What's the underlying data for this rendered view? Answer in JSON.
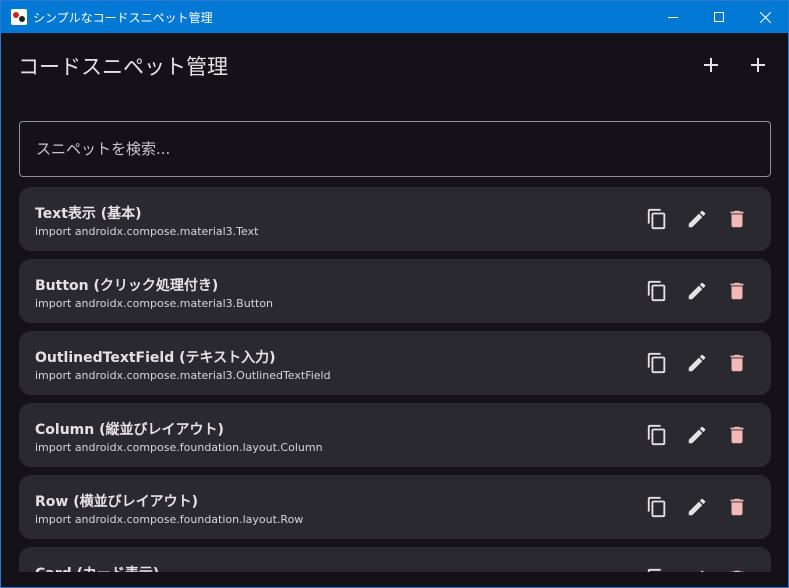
{
  "window": {
    "title": "シンプルなコードスニペット管理"
  },
  "header": {
    "title": "コードスニペット管理"
  },
  "search": {
    "placeholder": "スニペットを検索..."
  },
  "snippets": [
    {
      "title": "Text表示 (基本)",
      "code": "import androidx.compose.material3.Text"
    },
    {
      "title": "Button (クリック処理付き)",
      "code": "import androidx.compose.material3.Button"
    },
    {
      "title": "OutlinedTextField (テキスト入力)",
      "code": "import androidx.compose.material3.OutlinedTextField"
    },
    {
      "title": "Column (縦並びレイアウト)",
      "code": "import androidx.compose.foundation.layout.Column"
    },
    {
      "title": "Row (横並びレイアウト)",
      "code": "import androidx.compose.foundation.layout.Row"
    },
    {
      "title": "Card (カード表示)",
      "code": ""
    }
  ],
  "icons": {
    "copy": "copy-icon",
    "edit": "edit-icon",
    "delete": "delete-icon",
    "add": "plus-icon"
  },
  "colors": {
    "titlebar": "#0078d4",
    "background": "#141218",
    "card": "#2b2930",
    "delete": "#f2b8b5",
    "text": "#e6e1e5"
  }
}
